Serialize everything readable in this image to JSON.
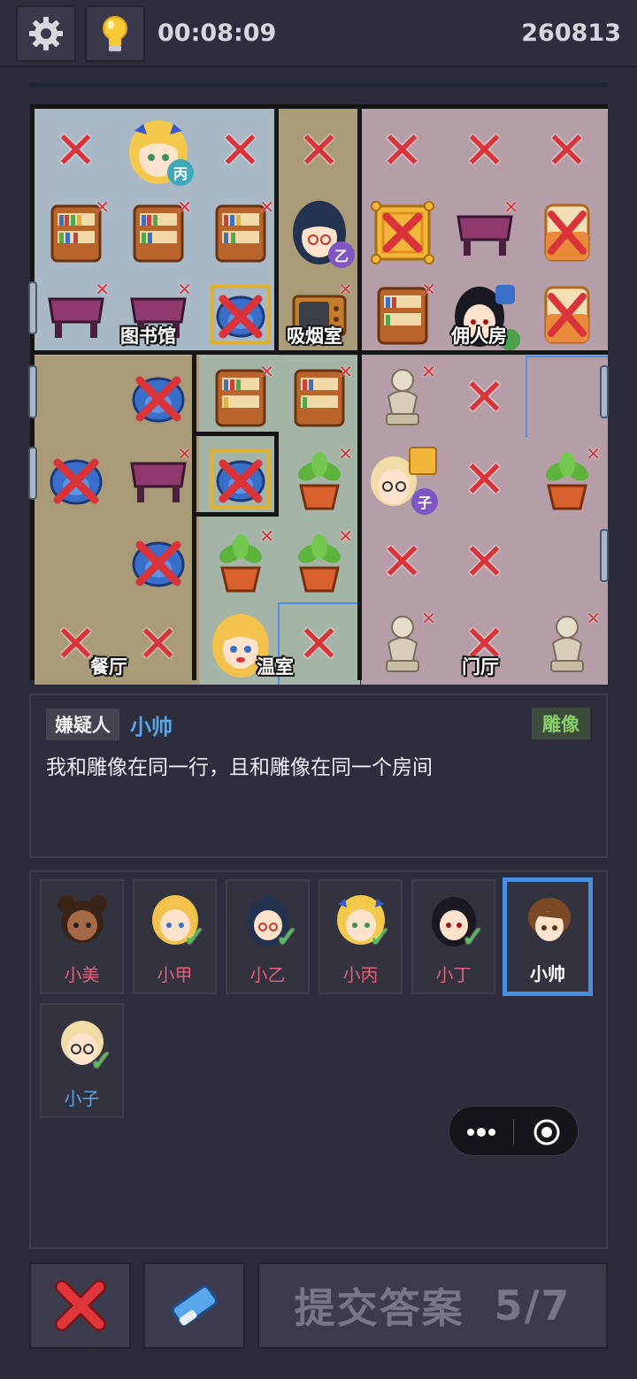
{
  "header": {
    "timer": "00:08:09",
    "score": "260813",
    "settings_icon": "gear-icon",
    "hint_icon": "lightbulb-icon"
  },
  "board": {
    "rows": 7,
    "cols": 7,
    "rooms": {
      "library": "图书馆",
      "smoking": "吸烟室",
      "servant": "佣人房",
      "dining": "餐厅",
      "greenhouse": "温室",
      "hall": "门厅"
    },
    "badges": {
      "bing": "丙",
      "yi": "乙",
      "zi": "子"
    }
  },
  "clue": {
    "tag": "嫌疑人",
    "name": "小帅",
    "target": "雕像",
    "text": "我和雕像在同一行，且和雕像在同一个房间"
  },
  "suspects": [
    {
      "name": "小美",
      "checked": false,
      "selected": false
    },
    {
      "name": "小甲",
      "checked": true,
      "selected": false
    },
    {
      "name": "小乙",
      "checked": true,
      "selected": false
    },
    {
      "name": "小丙",
      "checked": true,
      "selected": false
    },
    {
      "name": "小丁",
      "checked": true,
      "selected": false
    },
    {
      "name": "小帅",
      "checked": false,
      "selected": true
    },
    {
      "name": "小子",
      "checked": true,
      "selected": false
    }
  ],
  "footer": {
    "clear_icon": "red-x-icon",
    "eraser_icon": "eraser-icon",
    "submit_label": "提交答案",
    "progress": "5/7"
  },
  "colors": {
    "library": "#a8b8c6",
    "smoking": "#a99a78",
    "servant": "#b69ea8",
    "greenhouse": "#a4b4a6",
    "accent": "#4a90e2",
    "mark_red": "#d9343a",
    "check_green": "#4ec04e"
  }
}
